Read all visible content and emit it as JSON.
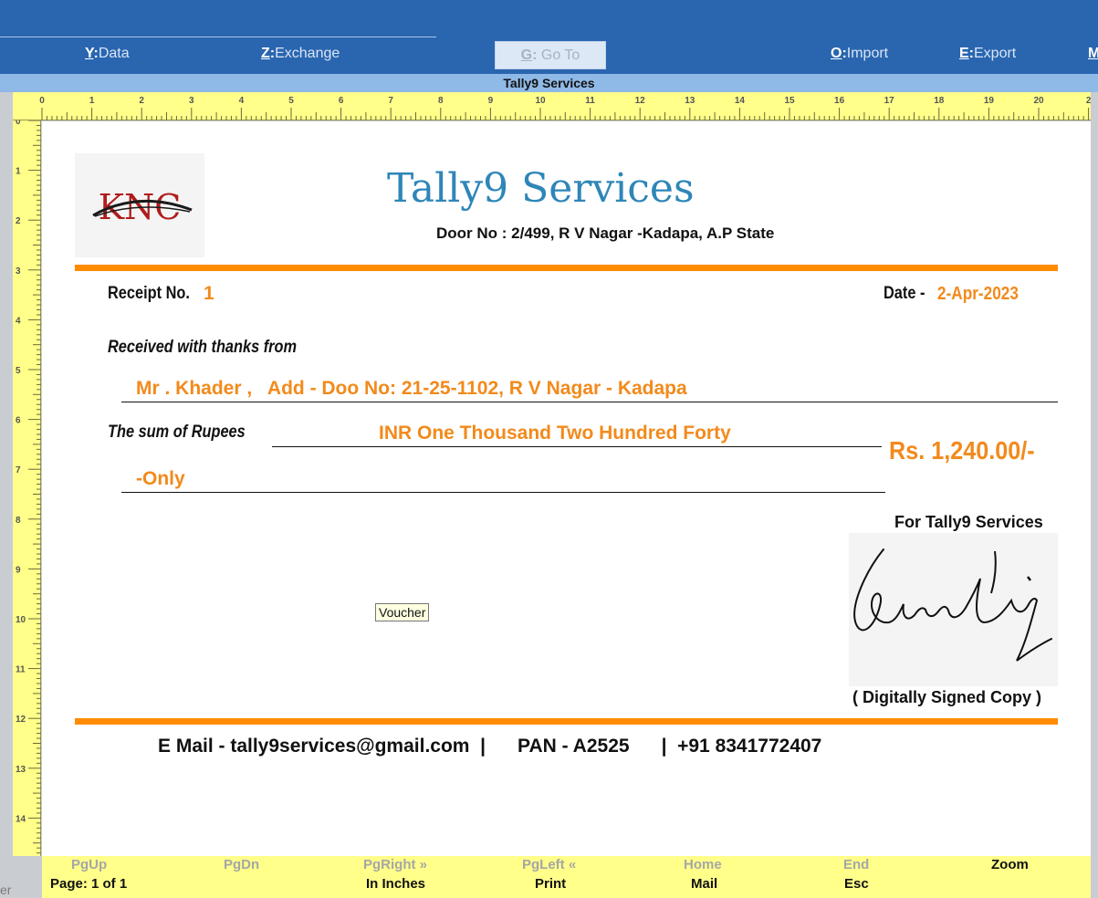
{
  "toolbar": {
    "items": [
      {
        "key": "Y",
        "label": "Data"
      },
      {
        "key": "Z",
        "label": "Exchange"
      },
      {
        "key": "G",
        "label": "Go To"
      },
      {
        "key": "O",
        "label": "Import"
      },
      {
        "key": "E",
        "label": "Export"
      },
      {
        "key": "M",
        "label": ""
      }
    ]
  },
  "window_title": "Tally9 Services",
  "ruler": {
    "top_ticks": [
      "0",
      "1",
      "2",
      "3",
      "4",
      "5",
      "6",
      "7",
      "8",
      "9",
      "10",
      "11",
      "12",
      "13",
      "14",
      "15",
      "16",
      "17",
      "18",
      "19",
      "20",
      "2"
    ],
    "left_ticks": [
      "0",
      "1",
      "2",
      "3",
      "4",
      "5",
      "6",
      "7",
      "8",
      "9",
      "10",
      "11",
      "12",
      "13",
      "14"
    ]
  },
  "left_cut_text": "er",
  "receipt": {
    "logo_text": "KNC",
    "company_name": "Tally9 Services",
    "address": "Door No : 2/499, R V Nagar -Kadapa, A.P State",
    "receipt_no_label": "Receipt No.",
    "receipt_no": "1",
    "date_label": "Date -",
    "date": "2-Apr-2023",
    "received_label": "Received with thanks from",
    "received_from": "Mr . Khader ,   Add - Doo No: 21-25-1102, R V Nagar - Kadapa",
    "sum_label": "The sum of Rupees",
    "amount_words": "INR One Thousand Two Hundred Forty",
    "amount_words_2": "-Only",
    "amount": "Rs. 1,240.00/-",
    "for_label": "For Tally9 Services",
    "signed_note": "( Digitally Signed Copy )",
    "footer": "E Mail - tally9services@gmail.com  |      PAN - A2525      |  +91 8341772407"
  },
  "tooltip": "Voucher",
  "bottom_bar": {
    "row1": [
      "PgUp",
      "PgDn",
      "PgRight »",
      "PgLeft «",
      "Home",
      "End",
      "Zoom"
    ],
    "row2": [
      "Page: 1 of 1",
      "",
      "In Inches",
      "Print",
      "Mail",
      "Esc",
      ""
    ]
  },
  "colors": {
    "toolbar_bg": "#2a66b0",
    "title_strip": "#8fb9e6",
    "ruler_bg": "#ffff8a",
    "accent_orange": "#ff8c00",
    "company_blue": "#2e86b8",
    "value_orange": "#f28a1c"
  }
}
